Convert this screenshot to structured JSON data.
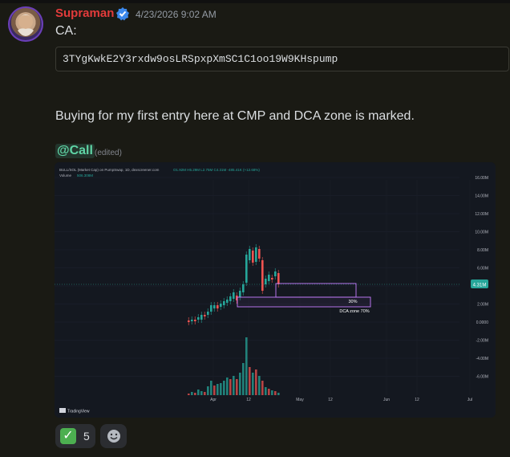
{
  "message": {
    "author": "Supraman",
    "timestamp": "4/23/2026 9:02 AM",
    "line1": "CA:",
    "contract_address": "3TYgKwkE2Y3rxdw9osLRSpxpXmSC1C1oo19W9KHspump",
    "body": "Buying for my first entry here at CMP and DCA zone is marked.",
    "mention": "@Call",
    "edited_label": "(edited)"
  },
  "chart": {
    "header": "BULL/SOL (Market Cap) on PumpSwap, 1D, dexscreener.com",
    "ohlc": "O1.92M H5.29M L2.75M C4.31M -485.41K (+12.68%)",
    "volume_label": "Volume",
    "volume_value": "506.308M",
    "current_price_tag": "4.31M",
    "zone_label_top": "30%",
    "zone_label_bottom": "DCA zone 70%",
    "y_ticks": [
      "16.00M",
      "14.00M",
      "12.00M",
      "10.00M",
      "8.00M",
      "6.00M",
      "4.00M",
      "2.00M",
      "0.0000",
      "-2.00M",
      "-4.00M",
      "-6.00M"
    ],
    "x_ticks": [
      "Apr",
      "12",
      "May",
      "12",
      "Jun",
      "12",
      "Jul"
    ],
    "watermark": "TradingView",
    "colors": {
      "up": "#26a69a",
      "down": "#ef5350",
      "zone": "#c77dff"
    }
  },
  "reactions": [
    {
      "emoji": "check-mark",
      "count": "5"
    },
    {
      "emoji": "add-reaction"
    }
  ]
}
